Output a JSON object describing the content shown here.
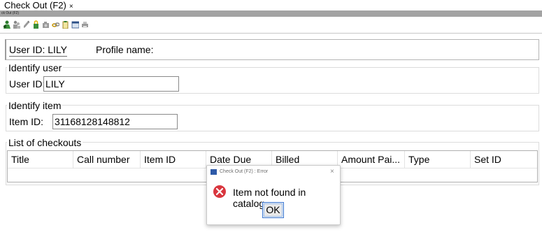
{
  "tab": {
    "title": "Check Out (F2)",
    "close": "×"
  },
  "strip_text": "ck Out (F2)",
  "toolbar": {
    "icons": [
      "user-checkout-icon",
      "users-icon",
      "edit-icon",
      "lock-icon",
      "camera-icon",
      "chain-icon",
      "clipboard-icon",
      "calendar-icon",
      "printer-icon"
    ]
  },
  "userbar": {
    "user_id_label": "User ID: LILY",
    "profile_label": "Profile name:"
  },
  "identify_user": {
    "title": "Identify user",
    "label": "User ID:",
    "value": "LILY"
  },
  "identify_item": {
    "title": "Identify item",
    "label": "Item ID:",
    "value": "31168128148812"
  },
  "checkouts": {
    "title": "List of checkouts",
    "columns": [
      "Title",
      "Call number",
      "Item ID",
      "Date Due",
      "Billed",
      "Amount Pai...",
      "Type",
      "Set ID"
    ]
  },
  "dialog": {
    "title": "Check Out (F2) : Error",
    "close": "×",
    "message": "Item not found in catalog",
    "ok": "OK"
  },
  "colors": {
    "strip": "#a3a3a3",
    "error_red": "#d9363e",
    "button_border": "#3d7bd9"
  }
}
